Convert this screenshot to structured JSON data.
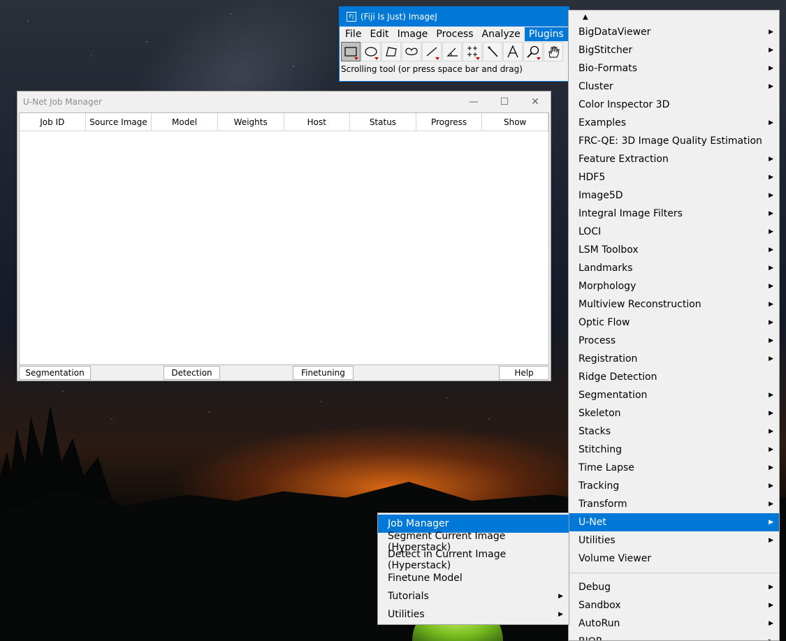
{
  "imagej": {
    "title": "(Fiji Is Just) ImageJ",
    "menus": [
      "File",
      "Edit",
      "Image",
      "Process",
      "Analyze",
      "Plugins"
    ],
    "active_menu": "Plugins",
    "tools": [
      "rectangle-tool",
      "oval-tool",
      "polygon-tool",
      "freehand-tool",
      "line-tool",
      "angle-tool",
      "point-tool",
      "wand-tool",
      "text-tool",
      "zoom-tool",
      "hand-tool"
    ],
    "status": "Scrolling tool (or press space bar and drag)"
  },
  "job_manager": {
    "title": "U-Net Job Manager",
    "columns": [
      "Job ID",
      "Source Image",
      "Model",
      "Weights",
      "Host",
      "Status",
      "Progress",
      "Show"
    ],
    "buttons": {
      "segmentation": "Segmentation",
      "detection": "Detection",
      "finetuning": "Finetuning",
      "help": "Help"
    }
  },
  "plugins_menu": {
    "items": [
      {
        "label": "BigDataViewer",
        "submenu": true
      },
      {
        "label": "BigStitcher",
        "submenu": true
      },
      {
        "label": "Bio-Formats",
        "submenu": true
      },
      {
        "label": "Cluster",
        "submenu": true
      },
      {
        "label": "Color Inspector 3D",
        "submenu": false
      },
      {
        "label": "Examples",
        "submenu": true
      },
      {
        "label": "FRC-QE: 3D Image Quality Estimation",
        "submenu": false
      },
      {
        "label": "Feature Extraction",
        "submenu": true
      },
      {
        "label": "HDF5",
        "submenu": true
      },
      {
        "label": "Image5D",
        "submenu": true
      },
      {
        "label": "Integral Image Filters",
        "submenu": true
      },
      {
        "label": "LOCI",
        "submenu": true
      },
      {
        "label": "LSM Toolbox",
        "submenu": true
      },
      {
        "label": "Landmarks",
        "submenu": true
      },
      {
        "label": "Morphology",
        "submenu": true
      },
      {
        "label": "Multiview Reconstruction",
        "submenu": true
      },
      {
        "label": "Optic Flow",
        "submenu": true
      },
      {
        "label": "Process",
        "submenu": true
      },
      {
        "label": "Registration",
        "submenu": true
      },
      {
        "label": "Ridge Detection",
        "submenu": false
      },
      {
        "label": "Segmentation",
        "submenu": true
      },
      {
        "label": "Skeleton",
        "submenu": true
      },
      {
        "label": "Stacks",
        "submenu": true
      },
      {
        "label": "Stitching",
        "submenu": true
      },
      {
        "label": "Time Lapse",
        "submenu": true
      },
      {
        "label": "Tracking",
        "submenu": true
      },
      {
        "label": "Transform",
        "submenu": true
      },
      {
        "label": "U-Net",
        "submenu": true,
        "highlight": true
      },
      {
        "label": "Utilities",
        "submenu": true
      },
      {
        "label": "Volume Viewer",
        "submenu": false
      }
    ],
    "after_separator": [
      {
        "label": "Debug",
        "submenu": true
      },
      {
        "label": "Sandbox",
        "submenu": true
      },
      {
        "label": "AutoRun",
        "submenu": true
      },
      {
        "label": "BIOP",
        "submenu": true
      }
    ]
  },
  "unet_submenu": {
    "items": [
      {
        "label": "Job Manager",
        "submenu": false,
        "highlight": true
      },
      {
        "label": "Segment Current Image (Hyperstack)",
        "submenu": false
      },
      {
        "label": "Detect in Current Image (Hyperstack)",
        "submenu": false
      },
      {
        "label": "Finetune Model",
        "submenu": false
      },
      {
        "label": "Tutorials",
        "submenu": true
      },
      {
        "label": "Utilities",
        "submenu": true
      }
    ]
  },
  "colors": {
    "accent": "#0078d7",
    "menu_bg": "#f0f0f0"
  }
}
